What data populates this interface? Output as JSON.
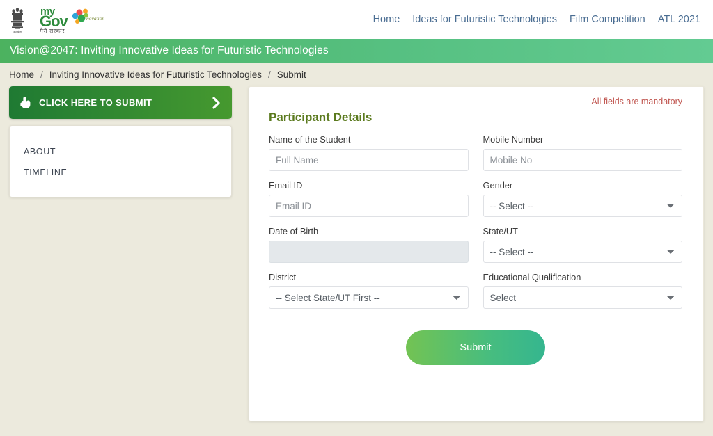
{
  "header": {
    "emblem_name": "india-state-emblem",
    "logo": {
      "my": "my",
      "gov": "Gov",
      "hindi": "मेरी सरकार",
      "innovation": "Innovation"
    },
    "nav": [
      {
        "label": "Home"
      },
      {
        "label": "Ideas for Futuristic Technologies"
      },
      {
        "label": "Film Competition"
      },
      {
        "label": "ATL 2021"
      }
    ]
  },
  "banner": {
    "title": "Vision@2047: Inviting Innovative Ideas for Futuristic Technologies"
  },
  "breadcrumb": {
    "items": [
      "Home",
      "Inviting Innovative Ideas for Futuristic Technologies",
      "Submit"
    ],
    "separator": "/"
  },
  "sidebar": {
    "cta_label": "CLICK HERE TO SUBMIT",
    "items": [
      {
        "label": "ABOUT"
      },
      {
        "label": "TIMELINE"
      }
    ]
  },
  "form": {
    "mandatory_note": "All fields are mandatory",
    "section_title": "Participant Details",
    "fields": {
      "name": {
        "label": "Name of the Student",
        "placeholder": "Full Name",
        "value": ""
      },
      "mobile": {
        "label": "Mobile Number",
        "placeholder": "Mobile No",
        "value": ""
      },
      "email": {
        "label": "Email ID",
        "placeholder": "Email ID",
        "value": ""
      },
      "gender": {
        "label": "Gender",
        "selected": "-- Select --"
      },
      "dob": {
        "label": "Date of Birth",
        "placeholder": "",
        "value": ""
      },
      "state": {
        "label": "State/UT",
        "selected": "-- Select --"
      },
      "district": {
        "label": "District",
        "selected": "-- Select State/UT First --"
      },
      "qualification": {
        "label": "Educational Qualification",
        "selected": "Select"
      }
    },
    "submit_label": "Submit"
  },
  "colors": {
    "page_bg": "#eceadd",
    "banner_from": "#4cb25f",
    "banner_to": "#63cb92",
    "cta_from": "#1f7a33",
    "cta_to": "#46992f",
    "section_title": "#5b7a1e",
    "mandatory": "#c0554f",
    "nav_link": "#4a6d92",
    "submit_from": "#73c353",
    "submit_to": "#35b68f"
  }
}
